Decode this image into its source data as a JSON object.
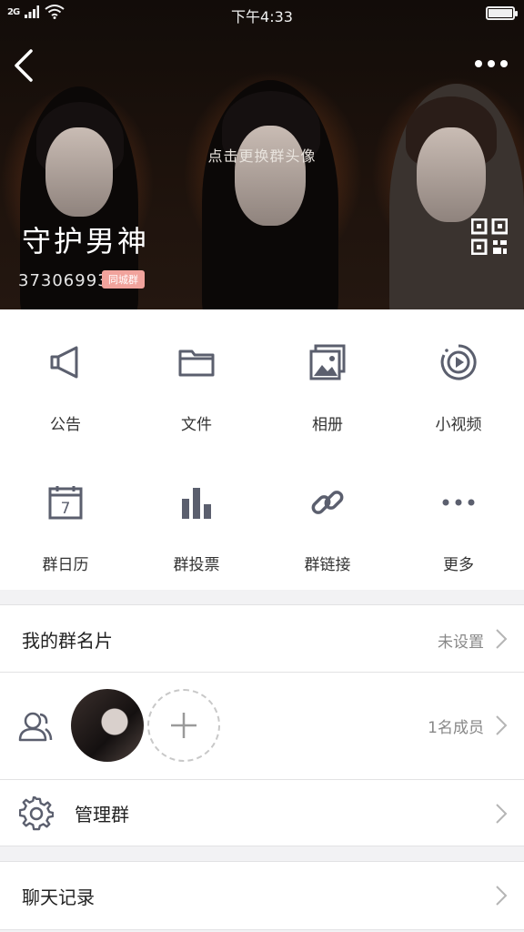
{
  "status_bar": {
    "network": "2G",
    "time": "下午4:33"
  },
  "header": {
    "change_avatar_hint": "点击更换群头像",
    "group_name": "守护男神",
    "group_id": "373069931",
    "group_badge": "同城群"
  },
  "features": [
    {
      "label": "公告",
      "icon": "megaphone-icon"
    },
    {
      "label": "文件",
      "icon": "folder-icon"
    },
    {
      "label": "相册",
      "icon": "photo-album-icon"
    },
    {
      "label": "小视频",
      "icon": "video-play-icon"
    },
    {
      "label": "群日历",
      "icon": "calendar-icon",
      "calendar_day": "7"
    },
    {
      "label": "群投票",
      "icon": "bar-chart-icon"
    },
    {
      "label": "群链接",
      "icon": "link-icon"
    },
    {
      "label": "更多",
      "icon": "more-dots-icon"
    }
  ],
  "group_card": {
    "title": "我的群名片",
    "value": "未设置"
  },
  "members": {
    "count_label": "1名成员"
  },
  "manage": {
    "title": "管理群"
  },
  "chat_history": {
    "title": "聊天记录"
  },
  "colors": {
    "icon": "#5b5f6e",
    "badge": "#f1a39c"
  }
}
